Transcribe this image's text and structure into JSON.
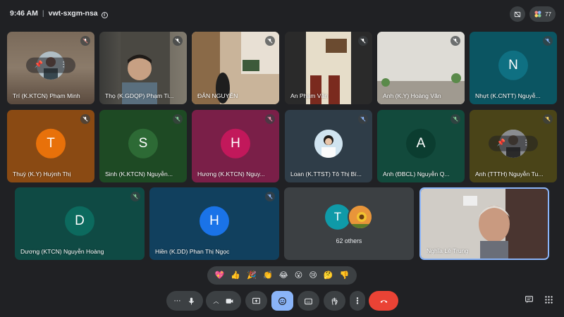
{
  "header": {
    "time": "9:46 AM",
    "meeting_code": "vwt-sxgm-nsa",
    "participant_count": "77"
  },
  "tiles": [
    {
      "name": "Trí (K.KTCN) Phạm Minh"
    },
    {
      "name": "Thọ (K.GDQP) Phạm Ti..."
    },
    {
      "name": "ĐẢN NGUYỄN"
    },
    {
      "name": "An Phạm Văn"
    },
    {
      "name": "Anh (K.Y) Hoàng Văn"
    },
    {
      "name": "Nhựt (K.CNTT) Nguyễ...",
      "initial": "N"
    },
    {
      "name": "Thuỳ (K.Y) Huỳnh Thị",
      "initial": "T"
    },
    {
      "name": "Sinh (K.KTCN) Nguyễn...",
      "initial": "S"
    },
    {
      "name": "Hương (K.KTCN) Nguy...",
      "initial": "H"
    },
    {
      "name": "Loan (K.TTST) Tô Thị Bí..."
    },
    {
      "name": "Anh (ĐBCL) Nguyễn Q...",
      "initial": "A"
    },
    {
      "name": "Anh (TTTH) Nguyễn Tu..."
    },
    {
      "name": "Dương (KTCN) Nguyễn Hoàng",
      "initial": "D"
    },
    {
      "name": "Hiền (K.DD) Phan Thị Ngọc",
      "initial": "H"
    },
    {
      "name": "62 others",
      "initial": "T"
    },
    {
      "name": "Nghĩa Lê Trung"
    }
  ],
  "reactions": [
    "💖",
    "👍",
    "🎉",
    "👏",
    "😂",
    "😮",
    "😢",
    "🤔",
    "👎"
  ],
  "colors": {
    "background": "#202124",
    "control": "#3c4043",
    "end_call": "#ea4335",
    "active_control": "#8ab4f8",
    "speaking_border": "#8ab4f8"
  }
}
